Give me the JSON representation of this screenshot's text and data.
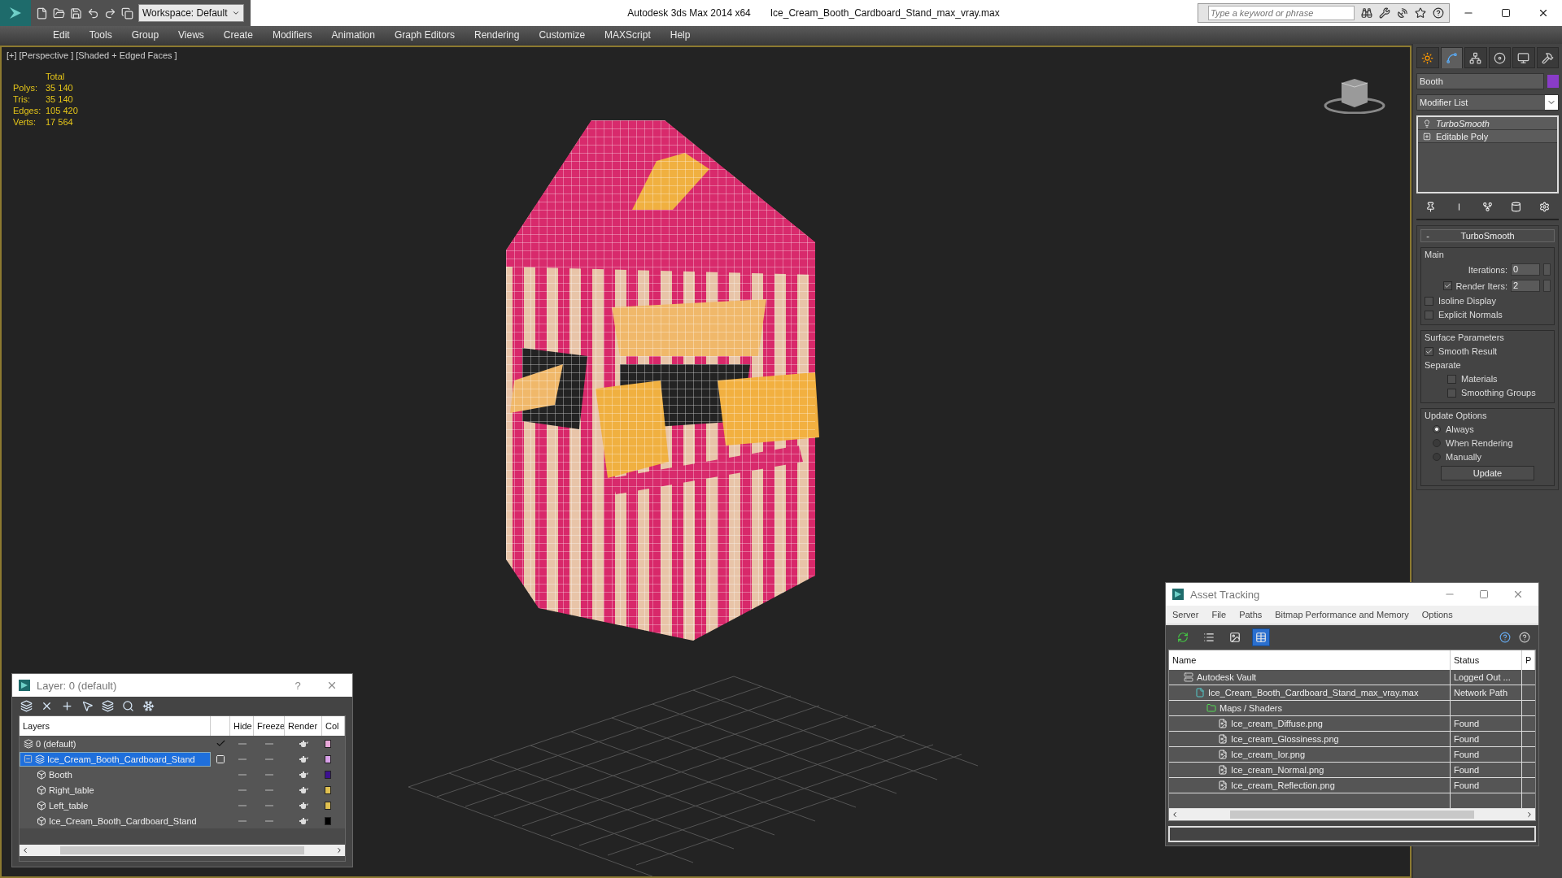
{
  "title_bar": {
    "workspace": "Workspace: Default",
    "app_title": "Autodesk 3ds Max  2014 x64",
    "file_title": "Ice_Cream_Booth_Cardboard_Stand_max_vray.max",
    "search": {
      "placeholder": "Type a keyword or phrase"
    }
  },
  "menu": [
    "Edit",
    "Tools",
    "Group",
    "Views",
    "Create",
    "Modifiers",
    "Animation",
    "Graph Editors",
    "Rendering",
    "Customize",
    "MAXScript",
    "Help"
  ],
  "viewport": {
    "labels": [
      "[+]",
      "[Perspective ]",
      "[Shaded + Edged Faces ]"
    ],
    "stats": {
      "header": "Total",
      "rows": [
        {
          "label": "Polys:",
          "value": "35 140"
        },
        {
          "label": "Tris:",
          "value": "35 140"
        },
        {
          "label": "Edges:",
          "value": "105 420"
        },
        {
          "label": "Verts:",
          "value": "17 564"
        }
      ]
    }
  },
  "command_panel": {
    "tabs": [
      {
        "kind": "create",
        "selected": false
      },
      {
        "kind": "modify",
        "selected": true
      },
      {
        "kind": "hierarchy",
        "selected": false
      },
      {
        "kind": "motion",
        "selected": false
      },
      {
        "kind": "display",
        "selected": false
      },
      {
        "kind": "utilities",
        "selected": false
      }
    ],
    "object": {
      "name": "Booth",
      "color": "#8a3cc8"
    },
    "modifier_list": "Modifier List",
    "stack": [
      {
        "label": "TurboSmooth",
        "kind": "modifier"
      },
      {
        "label": "Editable Poly",
        "kind": "base"
      }
    ],
    "rollout": {
      "title": "TurboSmooth",
      "collapse": "-",
      "main": {
        "title": "Main",
        "iterations": {
          "label": "Iterations:",
          "value": "0"
        },
        "render_iters": {
          "label": "Render Iters:",
          "value": "2",
          "checked": true
        },
        "checks": [
          {
            "label": "Isoline Display",
            "checked": false
          },
          {
            "label": "Explicit Normals",
            "checked": false
          }
        ]
      },
      "surface": {
        "title": "Surface Parameters",
        "smooth_result": {
          "label": "Smooth Result",
          "checked": true
        },
        "separate": "Separate",
        "checks": [
          {
            "label": "Materials",
            "checked": false
          },
          {
            "label": "Smoothing Groups",
            "checked": false
          }
        ]
      },
      "update": {
        "title": "Update Options",
        "options": [
          {
            "label": "Always",
            "selected": true
          },
          {
            "label": "When Rendering",
            "selected": false
          },
          {
            "label": "Manually",
            "selected": false
          }
        ],
        "button": "Update"
      }
    }
  },
  "layer_dialog": {
    "title": "Layer: 0 (default)",
    "help": "?",
    "columns": [
      "Layers",
      "Hide",
      "Freeze",
      "Render",
      "Col"
    ],
    "layers": [
      {
        "name": "0 (default)",
        "kind": "layer",
        "selected": false,
        "active": true,
        "color": "#e8a8d8"
      },
      {
        "name": "Ice_Cream_Booth_Cardboard_Stand",
        "kind": "layer",
        "selected": true,
        "active": false,
        "expanded": true,
        "color": "#d8a0e8",
        "children": [
          {
            "name": "Booth",
            "kind": "object",
            "selected": false,
            "color": "#3c1090"
          },
          {
            "name": "Right_table",
            "kind": "object",
            "selected": false,
            "color": "#e0c050"
          },
          {
            "name": "Left_table",
            "kind": "object",
            "selected": false,
            "color": "#e0c050"
          },
          {
            "name": "Ice_Cream_Booth_Cardboard_Stand",
            "kind": "object",
            "selected": false,
            "color": "#000000"
          }
        ]
      }
    ]
  },
  "asset_dialog": {
    "title": "Asset Tracking",
    "menu": [
      "Server",
      "File",
      "Paths",
      "Bitmap Performance and Memory",
      "Options"
    ],
    "toolbar": [
      {
        "kind": "refresh",
        "selected": false
      },
      {
        "kind": "list",
        "selected": false
      },
      {
        "kind": "thumbnails",
        "selected": false
      },
      {
        "kind": "table",
        "selected": true
      }
    ],
    "columns": [
      "Name",
      "Status",
      "P"
    ],
    "rows": [
      {
        "name": "Autodesk Vault",
        "status": "Logged Out ...",
        "kind": "vault",
        "children": [
          {
            "name": "Ice_Cream_Booth_Cardboard_Stand_max_vray.max",
            "status": "Network Path",
            "kind": "scene",
            "children": [
              {
                "name": "Maps / Shaders",
                "kind": "folder",
                "children": [
                  {
                    "name": "Ice_cream_Diffuse.png",
                    "status": "Found",
                    "kind": "image"
                  },
                  {
                    "name": "Ice_cream_Glossiness.png",
                    "status": "Found",
                    "kind": "image"
                  },
                  {
                    "name": "Ice_cream_Ior.png",
                    "status": "Found",
                    "kind": "image"
                  },
                  {
                    "name": "Ice_cream_Normal.png",
                    "status": "Found",
                    "kind": "image"
                  },
                  {
                    "name": "Ice_cream_Reflection.png",
                    "status": "Found",
                    "kind": "image"
                  }
                ]
              }
            ]
          }
        ]
      }
    ]
  }
}
